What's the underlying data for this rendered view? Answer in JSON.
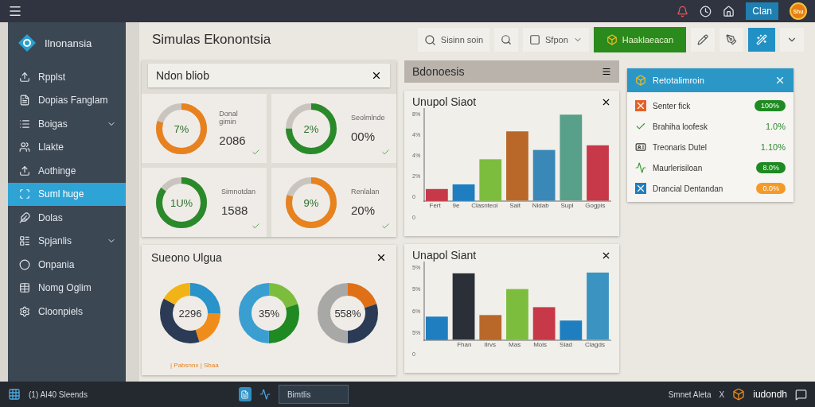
{
  "topbar": {
    "account_button": "Clan",
    "avatar": "Shu"
  },
  "sidebar": {
    "brand": "Ilnonansia",
    "items": [
      {
        "label": "Rpplst",
        "selected": false,
        "submenu": false
      },
      {
        "label": "Dopias Fanglam",
        "selected": false,
        "submenu": false
      },
      {
        "label": "Boigas",
        "selected": false,
        "submenu": true
      },
      {
        "label": "Llakte",
        "selected": false,
        "submenu": false
      },
      {
        "label": "Aothinge",
        "selected": false,
        "submenu": false
      },
      {
        "label": "Suml huge",
        "selected": true,
        "submenu": false
      },
      {
        "label": "Dolas",
        "selected": false,
        "submenu": false
      },
      {
        "label": "Spjanlis",
        "selected": false,
        "submenu": true
      },
      {
        "label": "Onpania",
        "selected": false,
        "submenu": false
      },
      {
        "label": "Nomg Oglim",
        "selected": false,
        "submenu": false
      },
      {
        "label": "Cloonpiels",
        "selected": false,
        "submenu": false
      }
    ]
  },
  "header": {
    "title": "Simulas Ekonontsia",
    "search": "Sisinn soin",
    "select": "Sfpon",
    "action_button": "Haaklaeacan"
  },
  "stats_panel": {
    "title": "Ndon bliob",
    "cards": [
      {
        "label": "Donal gimin",
        "value": "2086",
        "ring": "7%"
      },
      {
        "label": "Seolmlnde",
        "value": "00%",
        "ring": "2%"
      },
      {
        "label": "Simnotdan",
        "value": "1588",
        "ring": "1U%"
      },
      {
        "label": "Renlalan",
        "value": "20%",
        "ring": "9%"
      }
    ]
  },
  "donut_panel": {
    "title": "Sueono Ulgua",
    "donuts": [
      "2296",
      "35%",
      "558%"
    ],
    "legend": "| Pabsnnx | Sbaa"
  },
  "side_header": {
    "title": "Bdonoesis"
  },
  "charts": [
    {
      "title": "Unupol Siaot",
      "y_labels": [
        "8%",
        "4%",
        "4%",
        "2%",
        "0",
        "0"
      ],
      "x_labels": [
        "Fert",
        "9e",
        "Clasnteol",
        "Sait",
        "Nidab",
        "Supl",
        "Gogpis"
      ]
    },
    {
      "title": "Unapol Siant",
      "y_labels": [
        "5%",
        "5%",
        "6%",
        "5%",
        "0"
      ],
      "x_labels": [
        "Fhan",
        "Ilrvs",
        "Mas",
        "Mois",
        "Siad",
        "Clagds"
      ]
    }
  ],
  "info_panel": {
    "title": "Retotalimroin",
    "rows": [
      {
        "label": "Senter fick",
        "value": "100%",
        "kind": "badge",
        "color": "#1f8a22"
      },
      {
        "label": "Brahiha loofesk",
        "value": "1.0%",
        "kind": "plain"
      },
      {
        "label": "Treonaris Dutel",
        "value": "1.10%",
        "kind": "plain"
      },
      {
        "label": "Maurlerisiloan",
        "value": "8.0%",
        "kind": "badge",
        "color": "#1f8a22"
      },
      {
        "label": "Drancial Dentandan",
        "value": "0.0%",
        "kind": "badge",
        "color": "#f39a28"
      }
    ]
  },
  "taskbar": {
    "clock": "(1) AI40 Sleends",
    "window": "Bimtlis",
    "notice": "Smnet Aleta",
    "notice_close": "X",
    "app": "iudondh"
  }
}
